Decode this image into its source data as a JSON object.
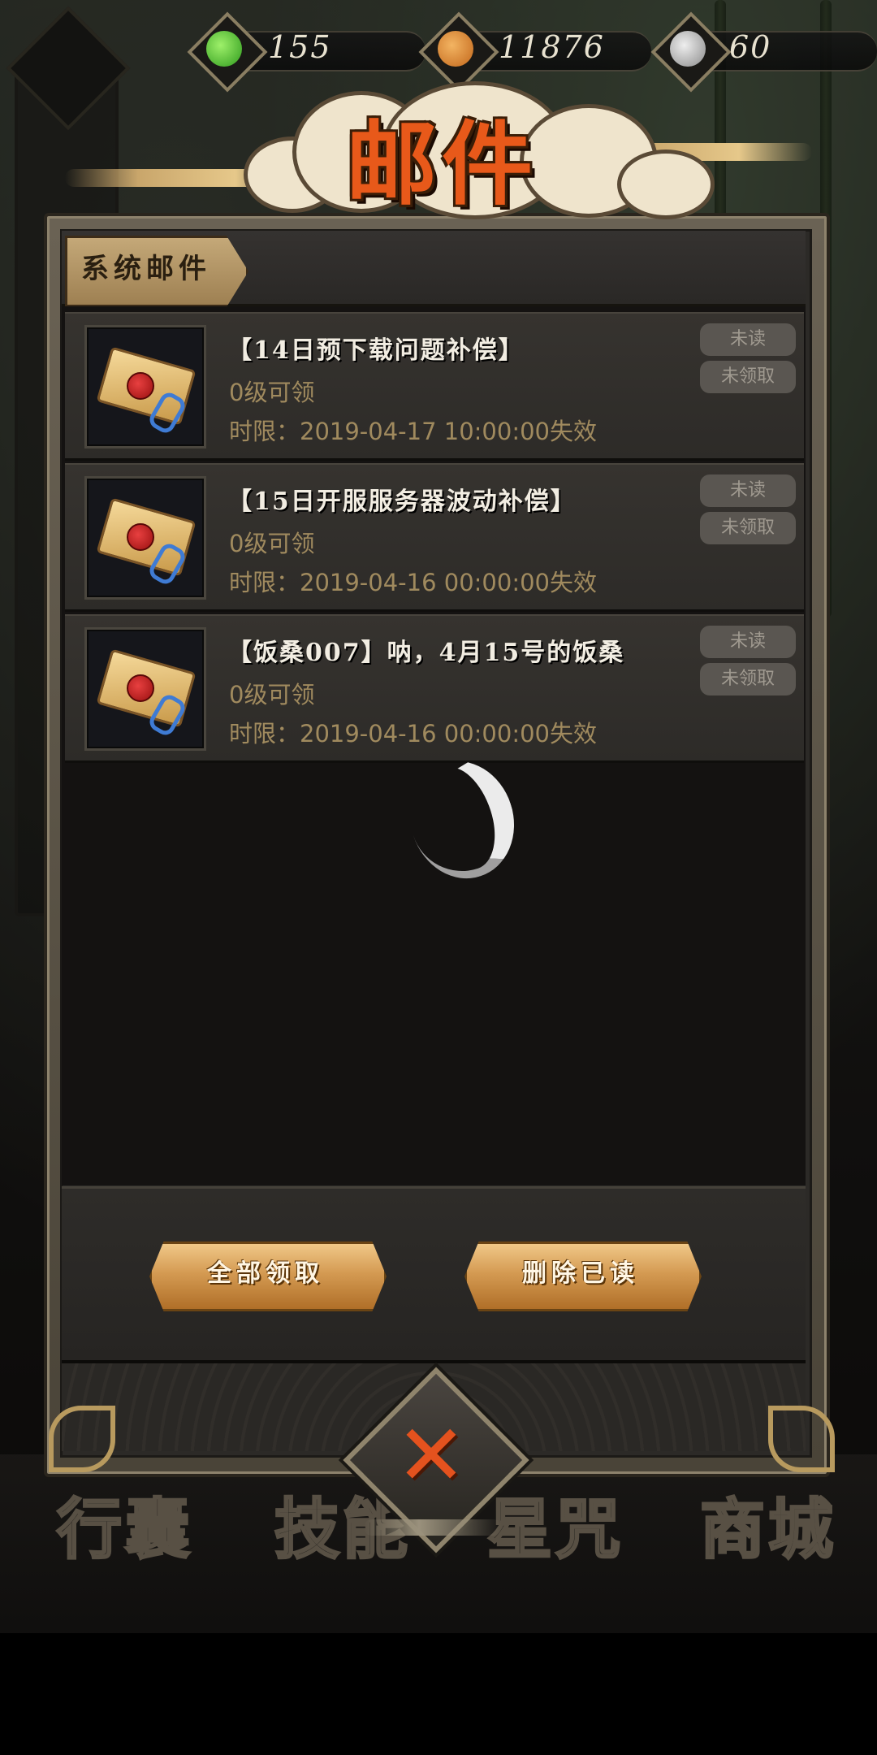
{
  "currency": {
    "jade": {
      "icon": "green-jade-icon",
      "value": "155"
    },
    "coin": {
      "icon": "copper-coin-icon",
      "value": "11876"
    },
    "stamina": {
      "icon": "swirl-token-icon",
      "value": "60"
    }
  },
  "title": "邮件",
  "tabs": [
    {
      "label": "系统邮件",
      "active": true
    }
  ],
  "mails": [
    {
      "title": "【14日预下载问题补偿】",
      "level": "0级可领",
      "deadline": "时限：2019-04-17 10:00:00失效",
      "read_status": "未读",
      "claim_status": "未领取"
    },
    {
      "title": "【15日开服服务器波动补偿】",
      "level": "0级可领",
      "deadline": "时限：2019-04-16 00:00:00失效",
      "read_status": "未读",
      "claim_status": "未领取"
    },
    {
      "title": "【饭桑007】呐，4月15号的饭桑",
      "level": "0级可领",
      "deadline": "时限：2019-04-16 00:00:00失效",
      "read_status": "未读",
      "claim_status": "未领取"
    }
  ],
  "actions": {
    "claim_all": "全部领取",
    "delete_read": "删除已读"
  },
  "bottom_nav": [
    "行囊",
    "技能",
    "星咒",
    "商城"
  ],
  "colors": {
    "title_orange": "#e8591a",
    "status_text": "#a08a5e",
    "gold_button": "#d49a52",
    "close_x": "#e4521e"
  }
}
